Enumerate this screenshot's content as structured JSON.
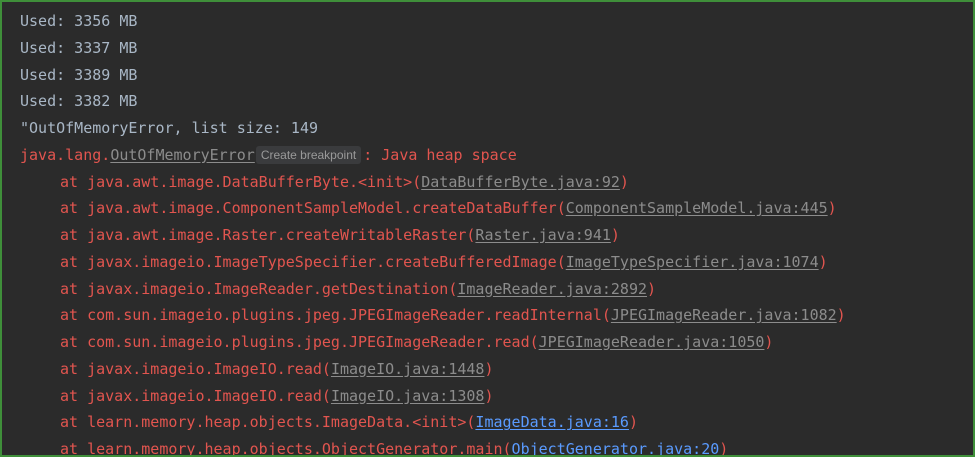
{
  "memory_lines": [
    "Used: 3356 MB",
    "Used: 3337 MB",
    "Used: 3389 MB",
    "Used: 3382 MB"
  ],
  "oom_line": "\"OutOfMemoryError, list size: 149",
  "exception": {
    "prefix": "java.lang.",
    "class_link": "OutOfMemoryError",
    "breakpoint_label": "Create breakpoint",
    "message": ": Java heap space"
  },
  "stack": [
    {
      "method": "at java.awt.image.DataBufferByte.<init>(",
      "source": "DataBufferByte.java:92",
      "suffix": ")"
    },
    {
      "method": "at java.awt.image.ComponentSampleModel.createDataBuffer(",
      "source": "ComponentSampleModel.java:445",
      "suffix": ")"
    },
    {
      "method": "at java.awt.image.Raster.createWritableRaster(",
      "source": "Raster.java:941",
      "suffix": ")"
    },
    {
      "method": "at javax.imageio.ImageTypeSpecifier.createBufferedImage(",
      "source": "ImageTypeSpecifier.java:1074",
      "suffix": ")"
    },
    {
      "method": "at javax.imageio.ImageReader.getDestination(",
      "source": "ImageReader.java:2892",
      "suffix": ")"
    },
    {
      "method": "at com.sun.imageio.plugins.jpeg.JPEGImageReader.readInternal(",
      "source": "JPEGImageReader.java:1082",
      "suffix": ")"
    },
    {
      "method": "at com.sun.imageio.plugins.jpeg.JPEGImageReader.read(",
      "source": "JPEGImageReader.java:1050",
      "suffix": ")"
    },
    {
      "method": "at javax.imageio.ImageIO.read(",
      "source": "ImageIO.java:1448",
      "suffix": ")"
    },
    {
      "method": "at javax.imageio.ImageIO.read(",
      "source": "ImageIO.java:1308",
      "suffix": ")"
    },
    {
      "method": "at learn.memory.heap.objects.ImageData.<init>(",
      "source": "ImageData.java:16",
      "suffix": ")"
    },
    {
      "method": "at learn.memory.heap.objects.ObjectGenerator.main(",
      "source": "ObjectGenerator.java:20",
      "suffix": ")"
    }
  ],
  "colors": {
    "background": "#2b2b2b",
    "border": "#3f8f3a",
    "stdout_text": "#a9b7c6",
    "error_text": "#e2554f",
    "library_link": "#8c8c8c",
    "user_link": "#5a9bff"
  }
}
